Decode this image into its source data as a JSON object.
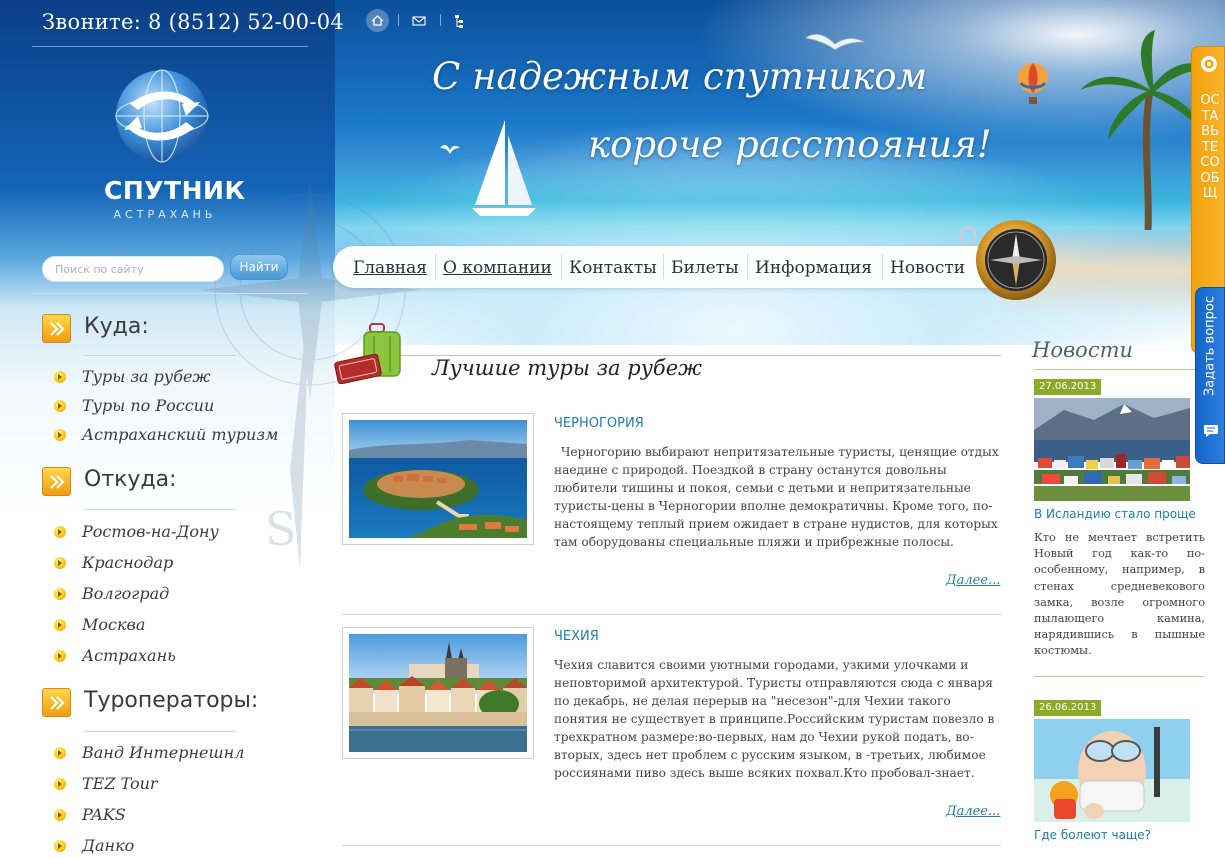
{
  "header": {
    "phone": "Звоните: 8 (8512) 52-00-04",
    "slogan_line1": "С надежным спутником",
    "slogan_line2": "короче расстояния!",
    "icons": [
      "home-icon",
      "mail-icon",
      "sitemap-icon"
    ]
  },
  "logo": {
    "title": "СПУТНИК",
    "subtitle": "АСТРАХАНЬ"
  },
  "search": {
    "placeholder": "Поиск по сайту",
    "value": "",
    "button_label": "Найти"
  },
  "nav": {
    "items": [
      {
        "label": "Главная"
      },
      {
        "label": "О компании"
      },
      {
        "label": "Контакты"
      },
      {
        "label": "Билеты"
      },
      {
        "label": "Информация"
      },
      {
        "label": "Новости"
      }
    ]
  },
  "sidebar": {
    "sections": [
      {
        "title": "Куда:",
        "items": [
          "Туры за рубеж",
          "Туры по России",
          "Астраханский туризм"
        ]
      },
      {
        "title": "Откуда:",
        "items": [
          "Ростов-на-Дону",
          "Краснодар",
          "Волгоград",
          "Москва",
          "Астрахань"
        ]
      },
      {
        "title": "Туроператоры:",
        "items": [
          "Ванд Интернешнл",
          "TEZ Tour",
          "PAKS",
          "Данко"
        ]
      }
    ]
  },
  "main": {
    "title": "Лучшие туры за рубеж",
    "more_label": "Далее...",
    "tours": [
      {
        "name": "ЧЕРНОГОРИЯ",
        "text": "Черногорию выбирают непритязательные туристы, ценящие отдых наедине с природой. Поездкой в страну останутся довольны любители тишины и покоя, семьи с детьми и непритязательные туристы-цены в Черногории вполне демократичны. Кроме того, по-настоящему теплый прием ожидает в стране нудистов, для которых там оборудованы специальные пляжи и прибрежные полосы."
      },
      {
        "name": "ЧЕХИЯ",
        "text": "Чехия славится своими уютными городами, узкими улочками и неповторимой архитектурой. Туристы отправляются сюда с января по декабрь, не делая перерыв на \"несезон\"-для Чехии такого понятия не существует в принципе.Российским туристам повезло в трехкратном размере:во-первых, нам до Чехии рукой подать, во-вторых, здесь нет проблем с русским языком, в -третьих, любимое россиянами пиво здесь выше всяких похвал.Кто пробовал-знает."
      }
    ]
  },
  "news": {
    "title": "Новости",
    "items": [
      {
        "date": "27.06.2013",
        "title": "В Исландию стало проще",
        "text": "Кто не мечтает встретить Новый год как-то по-особенному, например, в стенах средневекового замка, возле огромного пылающего камина, нарядившись в пышные костюмы."
      },
      {
        "date": "26.06.2013",
        "title": "Где болеют чаще?",
        "text": ""
      }
    ]
  },
  "right_tabs": {
    "feedback_label": "ОСТАВЬТЕ СООБЩ",
    "question_label": "Задать вопрос"
  },
  "colors": {
    "accent_link": "#1e7ea6",
    "date_badge": "#8caa28",
    "orange_tab": "#f4a10e",
    "blue_tab": "#1565c8"
  }
}
